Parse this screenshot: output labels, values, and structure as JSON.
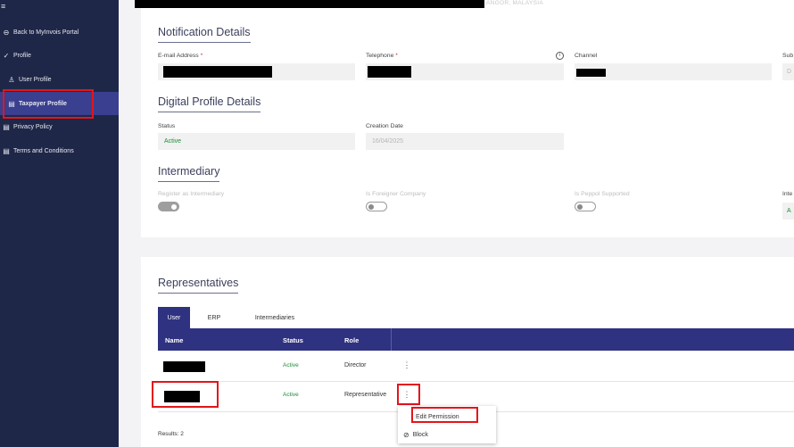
{
  "sidebar": {
    "menu_icon": "≡",
    "items": [
      {
        "label": "Back to MyInvois Portal",
        "icon": "back-circle-icon"
      },
      {
        "label": "Profile",
        "icon": "check-icon"
      },
      {
        "label": "User Profile",
        "icon": "user-icon"
      },
      {
        "label": "Taxpayer Profile",
        "icon": "document-icon"
      },
      {
        "label": "Privacy Policy",
        "icon": "document-icon"
      },
      {
        "label": "Terms and Conditions",
        "icon": "document-icon"
      }
    ]
  },
  "top": {
    "address_fragment": "ANGOR, MALAYSIA"
  },
  "notification": {
    "title": "Notification Details",
    "email_label": "E-mail Address",
    "telephone_label": "Telephone",
    "required_mark": "*",
    "channel_label": "Channel",
    "sub_label": "Sub",
    "sub_value": "D"
  },
  "digital": {
    "title": "Digital Profile Details",
    "status_label": "Status",
    "status_value": "Active",
    "creation_label": "Creation Date",
    "creation_value": "16/04/2025"
  },
  "intermediary": {
    "title": "Intermediary",
    "register_label": "Register as Intermediary",
    "foreigner_label": "Is Foreigner Company",
    "peppol_label": "Is Peppol Supported",
    "inte_label": "Inte",
    "inte_value": "A"
  },
  "representatives": {
    "title": "Representatives",
    "tabs": [
      "User",
      "ERP",
      "Intermediaries"
    ],
    "columns": [
      "Name",
      "Status",
      "Role"
    ],
    "rows": [
      {
        "status": "Active",
        "role": "Director"
      },
      {
        "status": "Active",
        "role": "Representative"
      }
    ],
    "menu": [
      "Edit Permission",
      "Block"
    ],
    "results": "Results: 2"
  },
  "colors": {
    "sidebar": "#1f2748",
    "accent": "#2e3280",
    "active_green": "#1e8c38",
    "highlight_red": "#e4151b"
  }
}
